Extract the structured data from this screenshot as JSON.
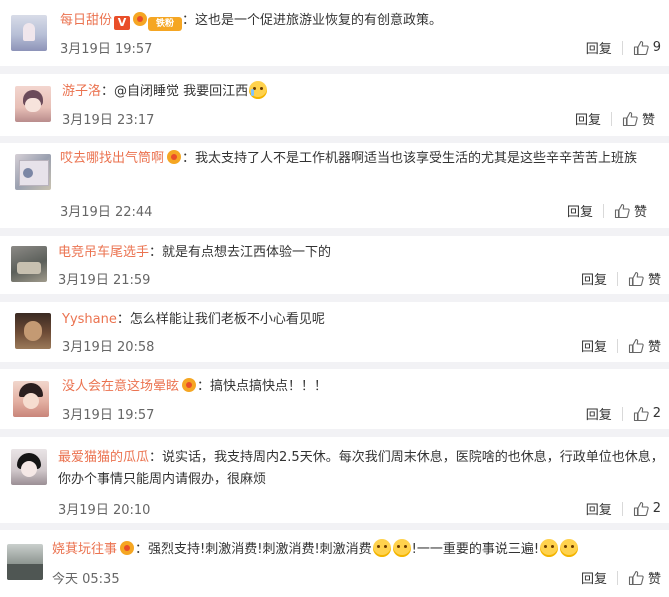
{
  "comments": [
    {
      "user": "每日甜份",
      "badges": [
        "v",
        "heart",
        "fans"
      ],
      "fans_label": "铁粉",
      "text": "这也是一个促进旅游业恢复的有创意政策。",
      "time": "3月19日 19:57",
      "reply": "回复",
      "like": "9",
      "emoji_after": []
    },
    {
      "user": "游子洛",
      "badges": [],
      "text": "@自闭睡觉 我要回江西",
      "time": "3月19日 23:17",
      "reply": "回复",
      "like": "赞",
      "emoji_after": [
        "cry"
      ]
    },
    {
      "user": "哎去哪找出气筒啊",
      "badges": [
        "heart"
      ],
      "text": "我太支持了人不是工作机器啊适当也该享受生活的尤其是这些辛辛苦苦上班族",
      "time": "3月19日 22:44",
      "reply": "回复",
      "like": "赞",
      "emoji_after": []
    },
    {
      "user": "电竞吊车尾选手",
      "badges": [],
      "text": "就是有点想去江西体验一下的",
      "time": "3月19日 21:59",
      "reply": "回复",
      "like": "赞",
      "emoji_after": []
    },
    {
      "user": "Yyshane",
      "badges": [],
      "text": "怎么样能让我们老板不小心看见呢",
      "time": "3月19日 20:58",
      "reply": "回复",
      "like": "赞",
      "emoji_after": []
    },
    {
      "user": "没人会在意这场晕眩",
      "badges": [
        "heart"
      ],
      "text": "搞快点搞快点！！！",
      "time": "3月19日 19:57",
      "reply": "回复",
      "like": "2",
      "emoji_after": []
    },
    {
      "user": "最爱猫猫的瓜瓜",
      "badges": [],
      "text": "说实话，我支持周内2.5天休。每次我们周末休息，医院啥的也休息，行政单位也休息，你办个事情只能周内请假办，很麻烦",
      "time": "3月19日 20:10",
      "reply": "回复",
      "like": "2",
      "emoji_after": []
    },
    {
      "user": "娆萁坃往事",
      "badges": [
        "heart"
      ],
      "text_parts": [
        "强烈支持!刺激消费!刺激消费!刺激消费",
        "!一一重要的事说三遍!"
      ],
      "time": "今天 05:35",
      "reply": "回复",
      "like": "赞"
    }
  ],
  "colors": {
    "username": "#eb7350",
    "background": "#f2f2f5",
    "card": "#ffffff"
  },
  "icons": [
    "thumbs-up-icon",
    "vip-v-icon",
    "heart-badge-icon",
    "emoji-icon"
  ]
}
